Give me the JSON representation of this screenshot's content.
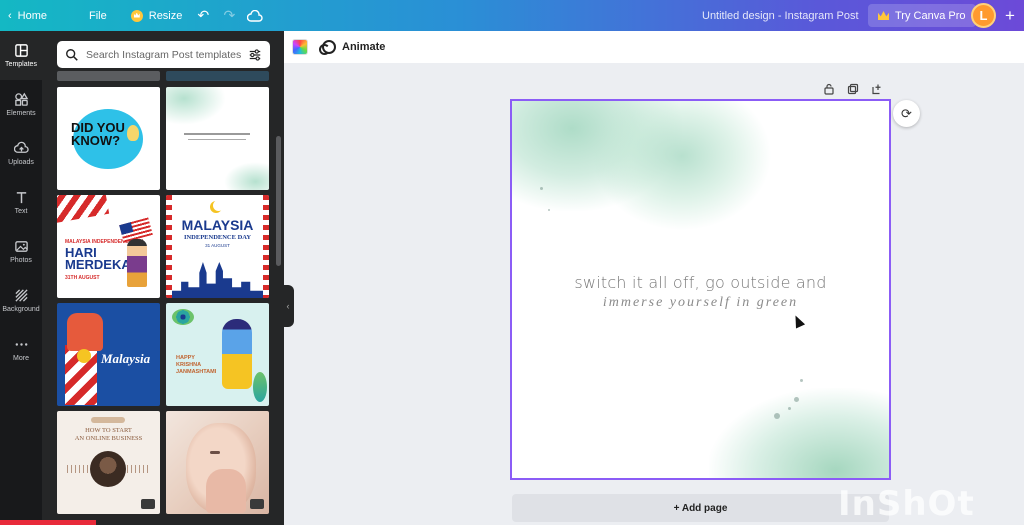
{
  "topbar": {
    "home": "Home",
    "file": "File",
    "resize": "Resize",
    "design_title": "Untitled design - Instagram Post",
    "try_pro": "Try Canva Pro",
    "avatar_initial": "L"
  },
  "rail": {
    "items": [
      {
        "label": "Templates",
        "icon": "templates-icon"
      },
      {
        "label": "Elements",
        "icon": "elements-icon"
      },
      {
        "label": "Uploads",
        "icon": "upload-icon"
      },
      {
        "label": "Text",
        "icon": "text-icon"
      },
      {
        "label": "Photos",
        "icon": "photos-icon"
      },
      {
        "label": "Background",
        "icon": "background-icon"
      },
      {
        "label": "More",
        "icon": "more-icon"
      }
    ]
  },
  "panel": {
    "search_placeholder": "Search Instagram Post templates",
    "templates": [
      {
        "text": "DID YOU KNOW?"
      },
      {
        "text": ""
      },
      {
        "kicker": "MALAYSIA INDEPENDENCE DAY",
        "title_line1": "HARI",
        "title_line2": "MERDEKA",
        "date": "31TH AUGUST"
      },
      {
        "title": "MALAYSIA",
        "subtitle": "INDEPENDENCE DAY",
        "date": "31 AUGUST"
      },
      {
        "title": "Malaysia"
      },
      {
        "line1": "HAPPY",
        "line2": "KRISHNA",
        "line3": "JANMASHTAMI"
      },
      {
        "title_line1": "HOW TO START",
        "title_line2": "AN ONLINE BUSINESS"
      },
      {
        "text": ""
      }
    ]
  },
  "editor": {
    "animate": "Animate",
    "canvas_line1": "switch it all off, go outside and",
    "canvas_line2": "immerse yourself in green",
    "add_page": "+ Add page",
    "watermark": "InShOt"
  },
  "colors": {
    "accent": "#8b5cf6",
    "avatar_bg": "#ff9a2e",
    "crown": "#ffc73a"
  }
}
